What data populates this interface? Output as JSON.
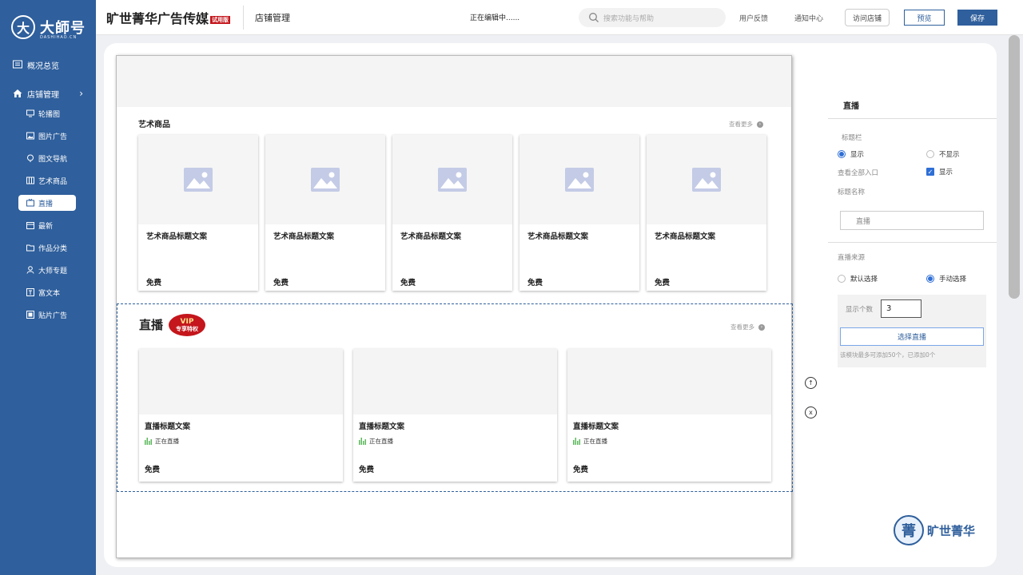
{
  "sidebar": {
    "logo": {
      "mark": "大",
      "name": "大師号",
      "sub": "DASHIHAO.CN"
    },
    "overview_label": "概况总览",
    "store_label": "店铺管理",
    "items": [
      {
        "label": "轮播图",
        "icon": "monitor-icon"
      },
      {
        "label": "图片广告",
        "icon": "image-icon"
      },
      {
        "label": "图文导航",
        "icon": "compass-icon"
      },
      {
        "label": "艺术商品",
        "icon": "columns-icon"
      },
      {
        "label": "直播",
        "icon": "tv-icon",
        "active": true
      },
      {
        "label": "最新",
        "icon": "calendar-icon"
      },
      {
        "label": "作品分类",
        "icon": "folder-icon"
      },
      {
        "label": "大师专题",
        "icon": "user-icon"
      },
      {
        "label": "富文本",
        "icon": "text-icon"
      },
      {
        "label": "贴片广告",
        "icon": "sticker-icon"
      }
    ]
  },
  "topbar": {
    "brand": "旷世菁华广告传媒",
    "trial_badge": "试用版",
    "crumb": "店铺管理",
    "editing": "正在编辑中......",
    "search_placeholder": "搜索功能与帮助",
    "feedback": "用户反馈",
    "notifications": "通知中心",
    "visit": "访问店铺",
    "preview": "预览",
    "save": "保存"
  },
  "canvas": {
    "art_section": {
      "title": "艺术商品",
      "more": "查看更多",
      "cards": [
        {
          "title": "艺术商品标题文案",
          "price": "免费"
        },
        {
          "title": "艺术商品标题文案",
          "price": "免费"
        },
        {
          "title": "艺术商品标题文案",
          "price": "免费"
        },
        {
          "title": "艺术商品标题文案",
          "price": "免费"
        },
        {
          "title": "艺术商品标题文案",
          "price": "免费"
        }
      ]
    },
    "live_section": {
      "title": "直播",
      "vip_top": "VIP",
      "vip_bottom": "专享特权",
      "more": "查看更多",
      "cards": [
        {
          "title": "直播标题文案",
          "status": "正在直播",
          "price": "免费"
        },
        {
          "title": "直播标题文案",
          "status": "正在直播",
          "price": "免费"
        },
        {
          "title": "直播标题文案",
          "status": "正在直播",
          "price": "免费"
        }
      ]
    },
    "controls": {
      "up": "↑",
      "close": "x"
    }
  },
  "panel": {
    "heading": "直播",
    "title_bar_label": "标题栏",
    "show": "显示",
    "hide": "不显示",
    "view_all_label": "查看全部入口",
    "view_all_show": "显示",
    "title_name_label": "标题名称",
    "title_name_value": "直播",
    "source_label": "直播来源",
    "source_default": "默认选择",
    "source_manual": "手动选择",
    "count_label": "显示个数",
    "count_value": "3",
    "choose_button": "选择直播",
    "hint": "该模块最多可添加50个，已添加0个"
  },
  "corner_logo": {
    "mark": "菁",
    "text": "旷世菁华"
  },
  "colors": {
    "brand_blue": "#2f5f9c",
    "accent_red": "#c4161c",
    "radio_blue": "#2f6fd6"
  }
}
